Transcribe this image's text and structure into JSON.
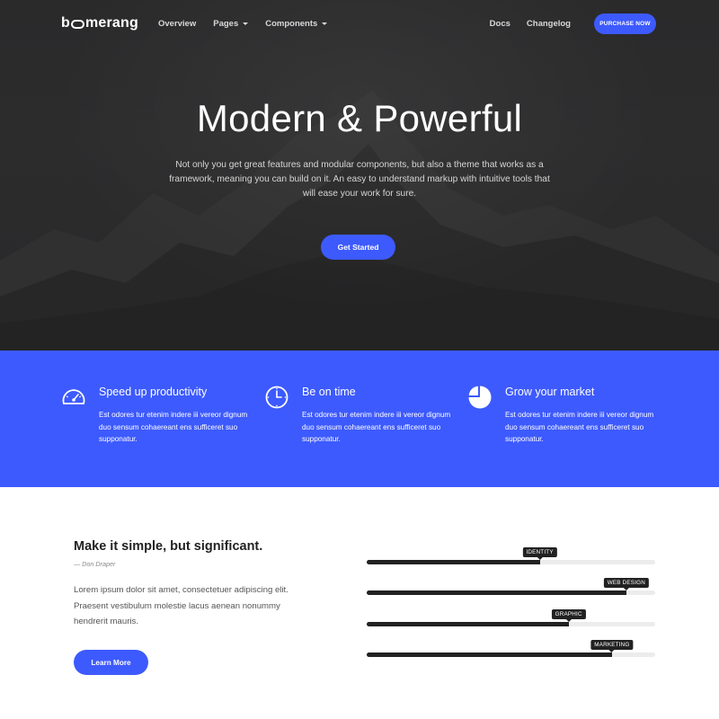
{
  "nav": {
    "brand": "boomerang",
    "links": [
      "Overview",
      "Pages",
      "Components"
    ],
    "right_links": [
      "Docs",
      "Changelog"
    ],
    "purchase_label": "PURCHASE NOW"
  },
  "hero": {
    "title": "Modern & Powerful",
    "text": "Not only you get great features and modular components, but also a theme that works as a framework, meaning you can build on it. An easy to understand markup with intuitive tools that will ease your work for sure.",
    "cta_label": "Get Started"
  },
  "features": [
    {
      "icon": "speedometer-icon",
      "title": "Speed up productivity",
      "text": "Est odores tur etenim indere iii vereor dignum duo sensum cohaereant ens sufficeret suo supponatur."
    },
    {
      "icon": "clock-icon",
      "title": "Be on time",
      "text": "Est odores tur etenim indere iii vereor dignum duo sensum cohaereant ens sufficeret suo supponatur."
    },
    {
      "icon": "pie-chart-icon",
      "title": "Grow your market",
      "text": "Est odores tur etenim indere iii vereor dignum duo sensum cohaereant ens sufficeret suo supponatur."
    }
  ],
  "quote": {
    "title": "Make it simple, but significant.",
    "author": "— Don Draper",
    "body": "Lorem ipsum dolor sit amet, consectetuer adipiscing elit. Praesent vestibulum molestie lacus aenean nonummy hendrerit mauris.",
    "cta_label": "Learn More"
  },
  "skills": [
    {
      "label": "IDENTITY",
      "value": 60
    },
    {
      "label": "WEB DESIGN",
      "value": 90
    },
    {
      "label": "GRAPHIC",
      "value": 70
    },
    {
      "label": "MARKETING",
      "value": 85
    }
  ],
  "colors": {
    "accent": "#3d5afe",
    "hero_bg": "#2b2b2c",
    "bar_fill": "#222222",
    "bar_track": "#ececec"
  }
}
